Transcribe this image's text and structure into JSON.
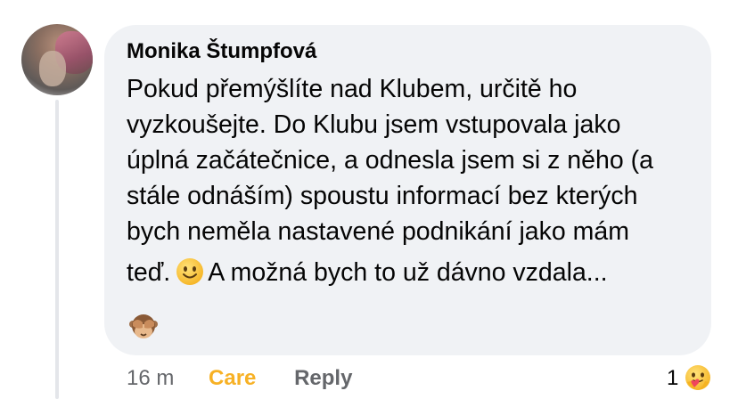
{
  "comment": {
    "author": "Monika Štumpfová",
    "lines": [
      "Pokud přemýšlíte nad Klubem, určitě ho",
      "vyzkoušejte. Do Klubu jsem vstupovala jako",
      "úplná začátečnice, a odnesla jsem si z něho (a",
      "stále odnáším) spoustu informací bez kterých",
      "bych neměla nastavené podnikání jako mám"
    ],
    "last_line_start": "teď.",
    "last_line_end": "A možná bych to už dávno vzdala...",
    "emoji_inline": "slightly-smiling-face-icon",
    "emoji_after": "see-no-evil-monkey-icon"
  },
  "actions": {
    "time": "16 m",
    "care_label": "Care",
    "reply_label": "Reply"
  },
  "reactions": {
    "count": "1",
    "type": "care-reaction-icon"
  },
  "colors": {
    "bubble": "#f0f2f5",
    "care": "#f7b125",
    "meta": "#65676b",
    "text": "#050505"
  }
}
